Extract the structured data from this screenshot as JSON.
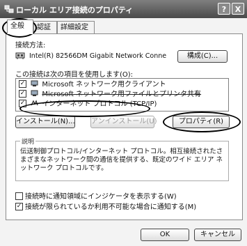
{
  "window": {
    "title": "ローカル エリア接続のプロパティ",
    "help_button": "?",
    "close_button": "X"
  },
  "tabs": [
    {
      "label": "全般",
      "active": true
    },
    {
      "label": "認証",
      "active": false
    },
    {
      "label": "詳細設定",
      "active": false
    }
  ],
  "general": {
    "connect_using_label": "接続方法:",
    "adapter_name": "Intel(R) 82566DM Gigabit Network Conne",
    "configure_button": "構成(C)...",
    "items_label": "この接続は次の項目を使用します(O):",
    "items": [
      {
        "label": "Microsoft ネットワーク用クライアント",
        "checked": true,
        "icon": "network-client-icon"
      },
      {
        "label": "Microsoft ネットワーク用ファイルとプリンタ共有",
        "checked": true,
        "icon": "file-printer-sharing-icon"
      },
      {
        "label": "インターネット プロトコル (TCP/IP)",
        "checked": true,
        "icon": "protocol-icon",
        "selected": true
      }
    ],
    "install_button": "インストール(N)...",
    "uninstall_button": "アンインストール(U)",
    "properties_button": "プロパティ(R)",
    "description_title": "説明",
    "description_text": "伝送制御プロトコル/インターネット プロトコル。相互接続されたさまざまなネットワーク間の通信を提供する、既定のワイド エリア ネットワーク プロトコルです。",
    "show_icon_label": "接続時に通知領域にインジケータを表示する(W)",
    "show_icon_checked": false,
    "notify_label": "接続が限られているか利用不可能な場合に通知する(M)",
    "notify_checked": true
  },
  "footer": {
    "ok_button": "OK",
    "cancel_button": "キャンセル"
  },
  "colors": {
    "titlebar": "#5a5a5a",
    "panel": "#ffffff",
    "annotation_oval": "#000000"
  }
}
